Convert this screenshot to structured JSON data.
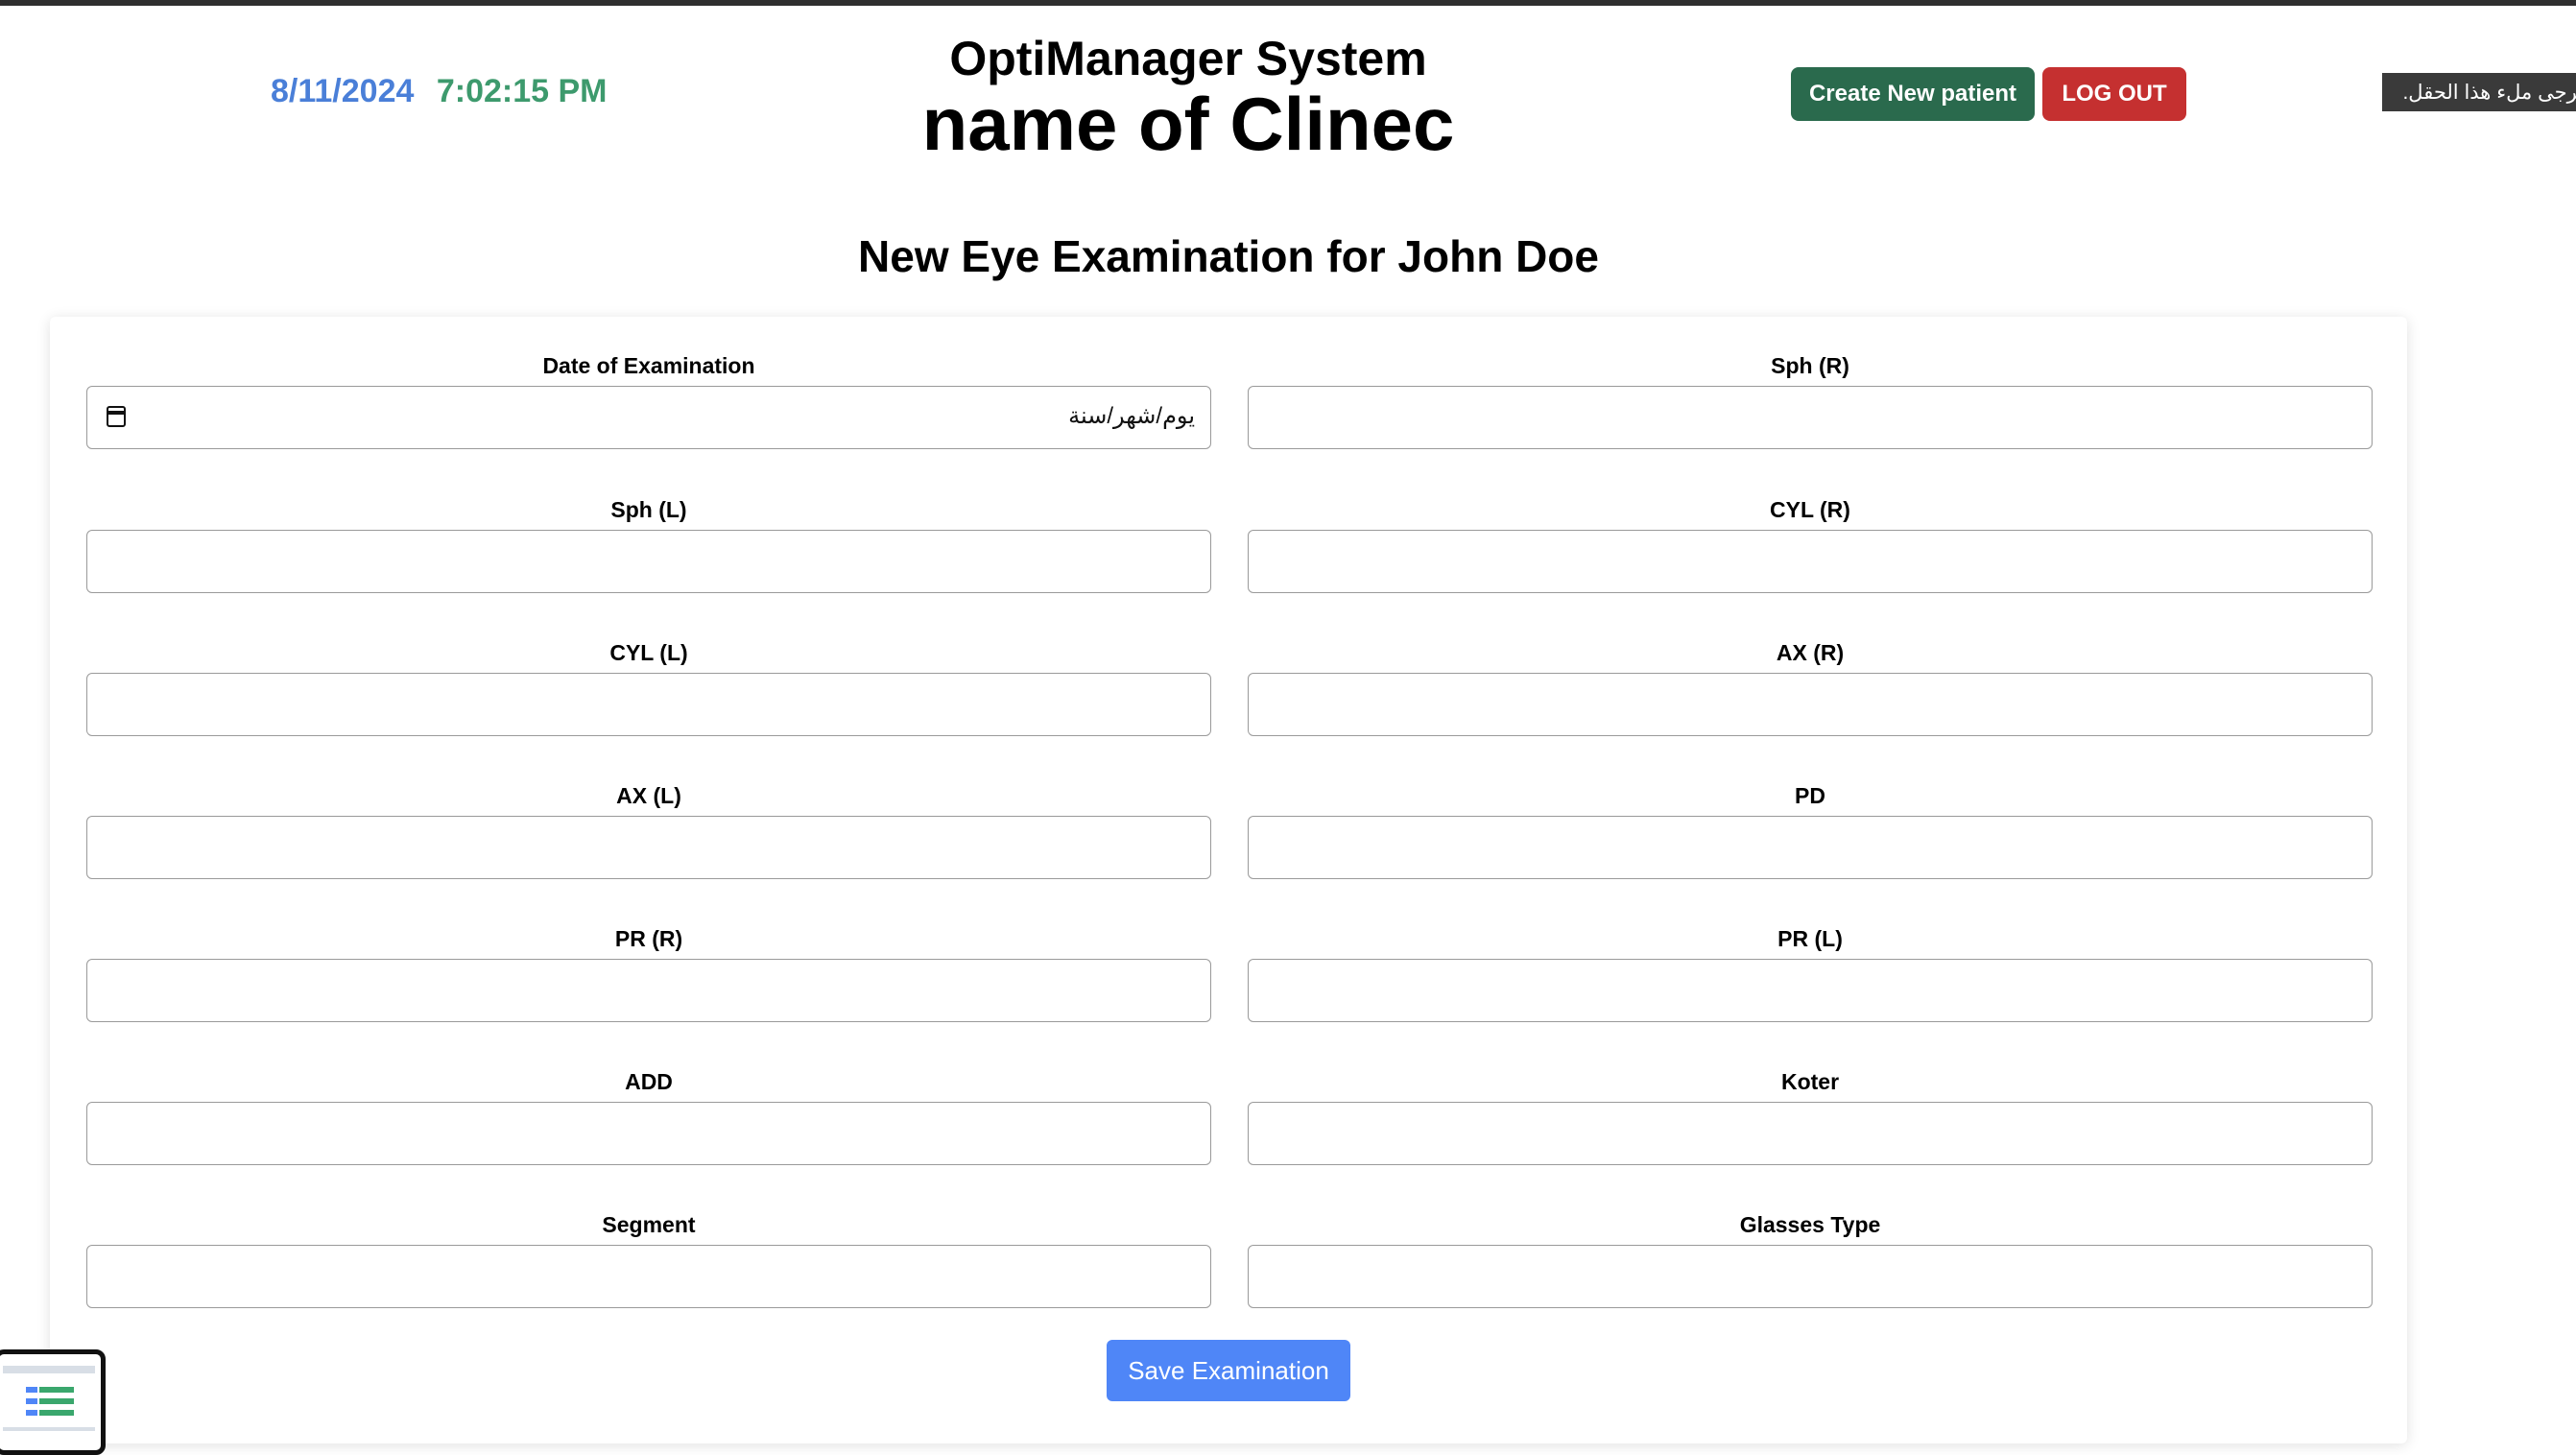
{
  "header": {
    "date": "8/11/2024",
    "time": "7:02:15 PM",
    "system_title": "OptiManager System",
    "clinic_name": "name of Clinec",
    "create_button": "Create New patient",
    "logout_button": "LOG OUT",
    "tooltip": "يُرجى ملء هذا الحقل."
  },
  "page_heading": "New Eye Examination for John Doe",
  "form": {
    "date_placeholder": "يوم/شهر/سنة",
    "fields": [
      {
        "label": "Date of Examination",
        "value": ""
      },
      {
        "label": "Sph (R)",
        "value": ""
      },
      {
        "label": "Sph (L)",
        "value": ""
      },
      {
        "label": "CYL (R)",
        "value": ""
      },
      {
        "label": "CYL (L)",
        "value": ""
      },
      {
        "label": "AX (R)",
        "value": ""
      },
      {
        "label": "AX (L)",
        "value": ""
      },
      {
        "label": "PD",
        "value": ""
      },
      {
        "label": "PR (R)",
        "value": ""
      },
      {
        "label": "PR (L)",
        "value": ""
      },
      {
        "label": "ADD",
        "value": ""
      },
      {
        "label": "Koter",
        "value": ""
      },
      {
        "label": "Segment",
        "value": ""
      },
      {
        "label": "Glasses Type",
        "value": ""
      }
    ],
    "save_button": "Save Examination"
  },
  "colors": {
    "date": "#4a7fd8",
    "time": "#3d9a6d",
    "create_button": "#2a6a4d",
    "logout_button": "#c53030",
    "save_button": "#4f86f7"
  }
}
